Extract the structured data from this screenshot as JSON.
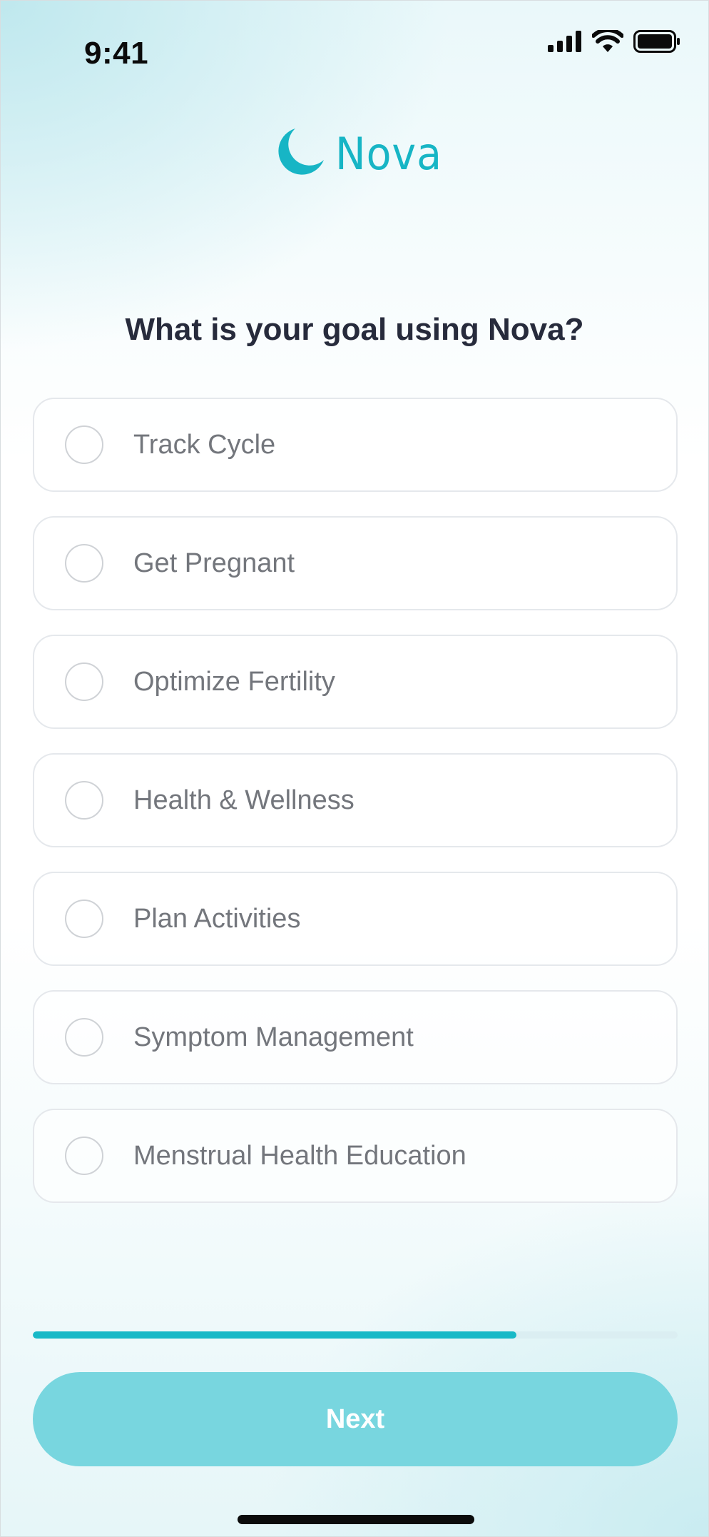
{
  "status_bar": {
    "time": "9:41",
    "icons": [
      "cellular-signal-icon",
      "wifi-icon",
      "battery-icon"
    ]
  },
  "brand": {
    "name": "Nova",
    "logo_icon": "crescent-moon-icon",
    "color": "#17b5c5"
  },
  "question": "What is your goal using Nova?",
  "options": [
    {
      "label": "Track Cycle",
      "selected": false
    },
    {
      "label": "Get Pregnant",
      "selected": false
    },
    {
      "label": "Optimize Fertility",
      "selected": false
    },
    {
      "label": "Health & Wellness",
      "selected": false
    },
    {
      "label": "Plan Activities",
      "selected": false
    },
    {
      "label": "Symptom Management",
      "selected": false
    },
    {
      "label": "Menstrual Health Education",
      "selected": false
    }
  ],
  "progress": {
    "fraction": 0.75,
    "color": "#18b9c7"
  },
  "next_button": {
    "label": "Next",
    "color": "#78d6df",
    "enabled": false
  },
  "colors": {
    "heading": "#272b3c",
    "option_text": "#73767c",
    "accent": "#18b9c7"
  }
}
